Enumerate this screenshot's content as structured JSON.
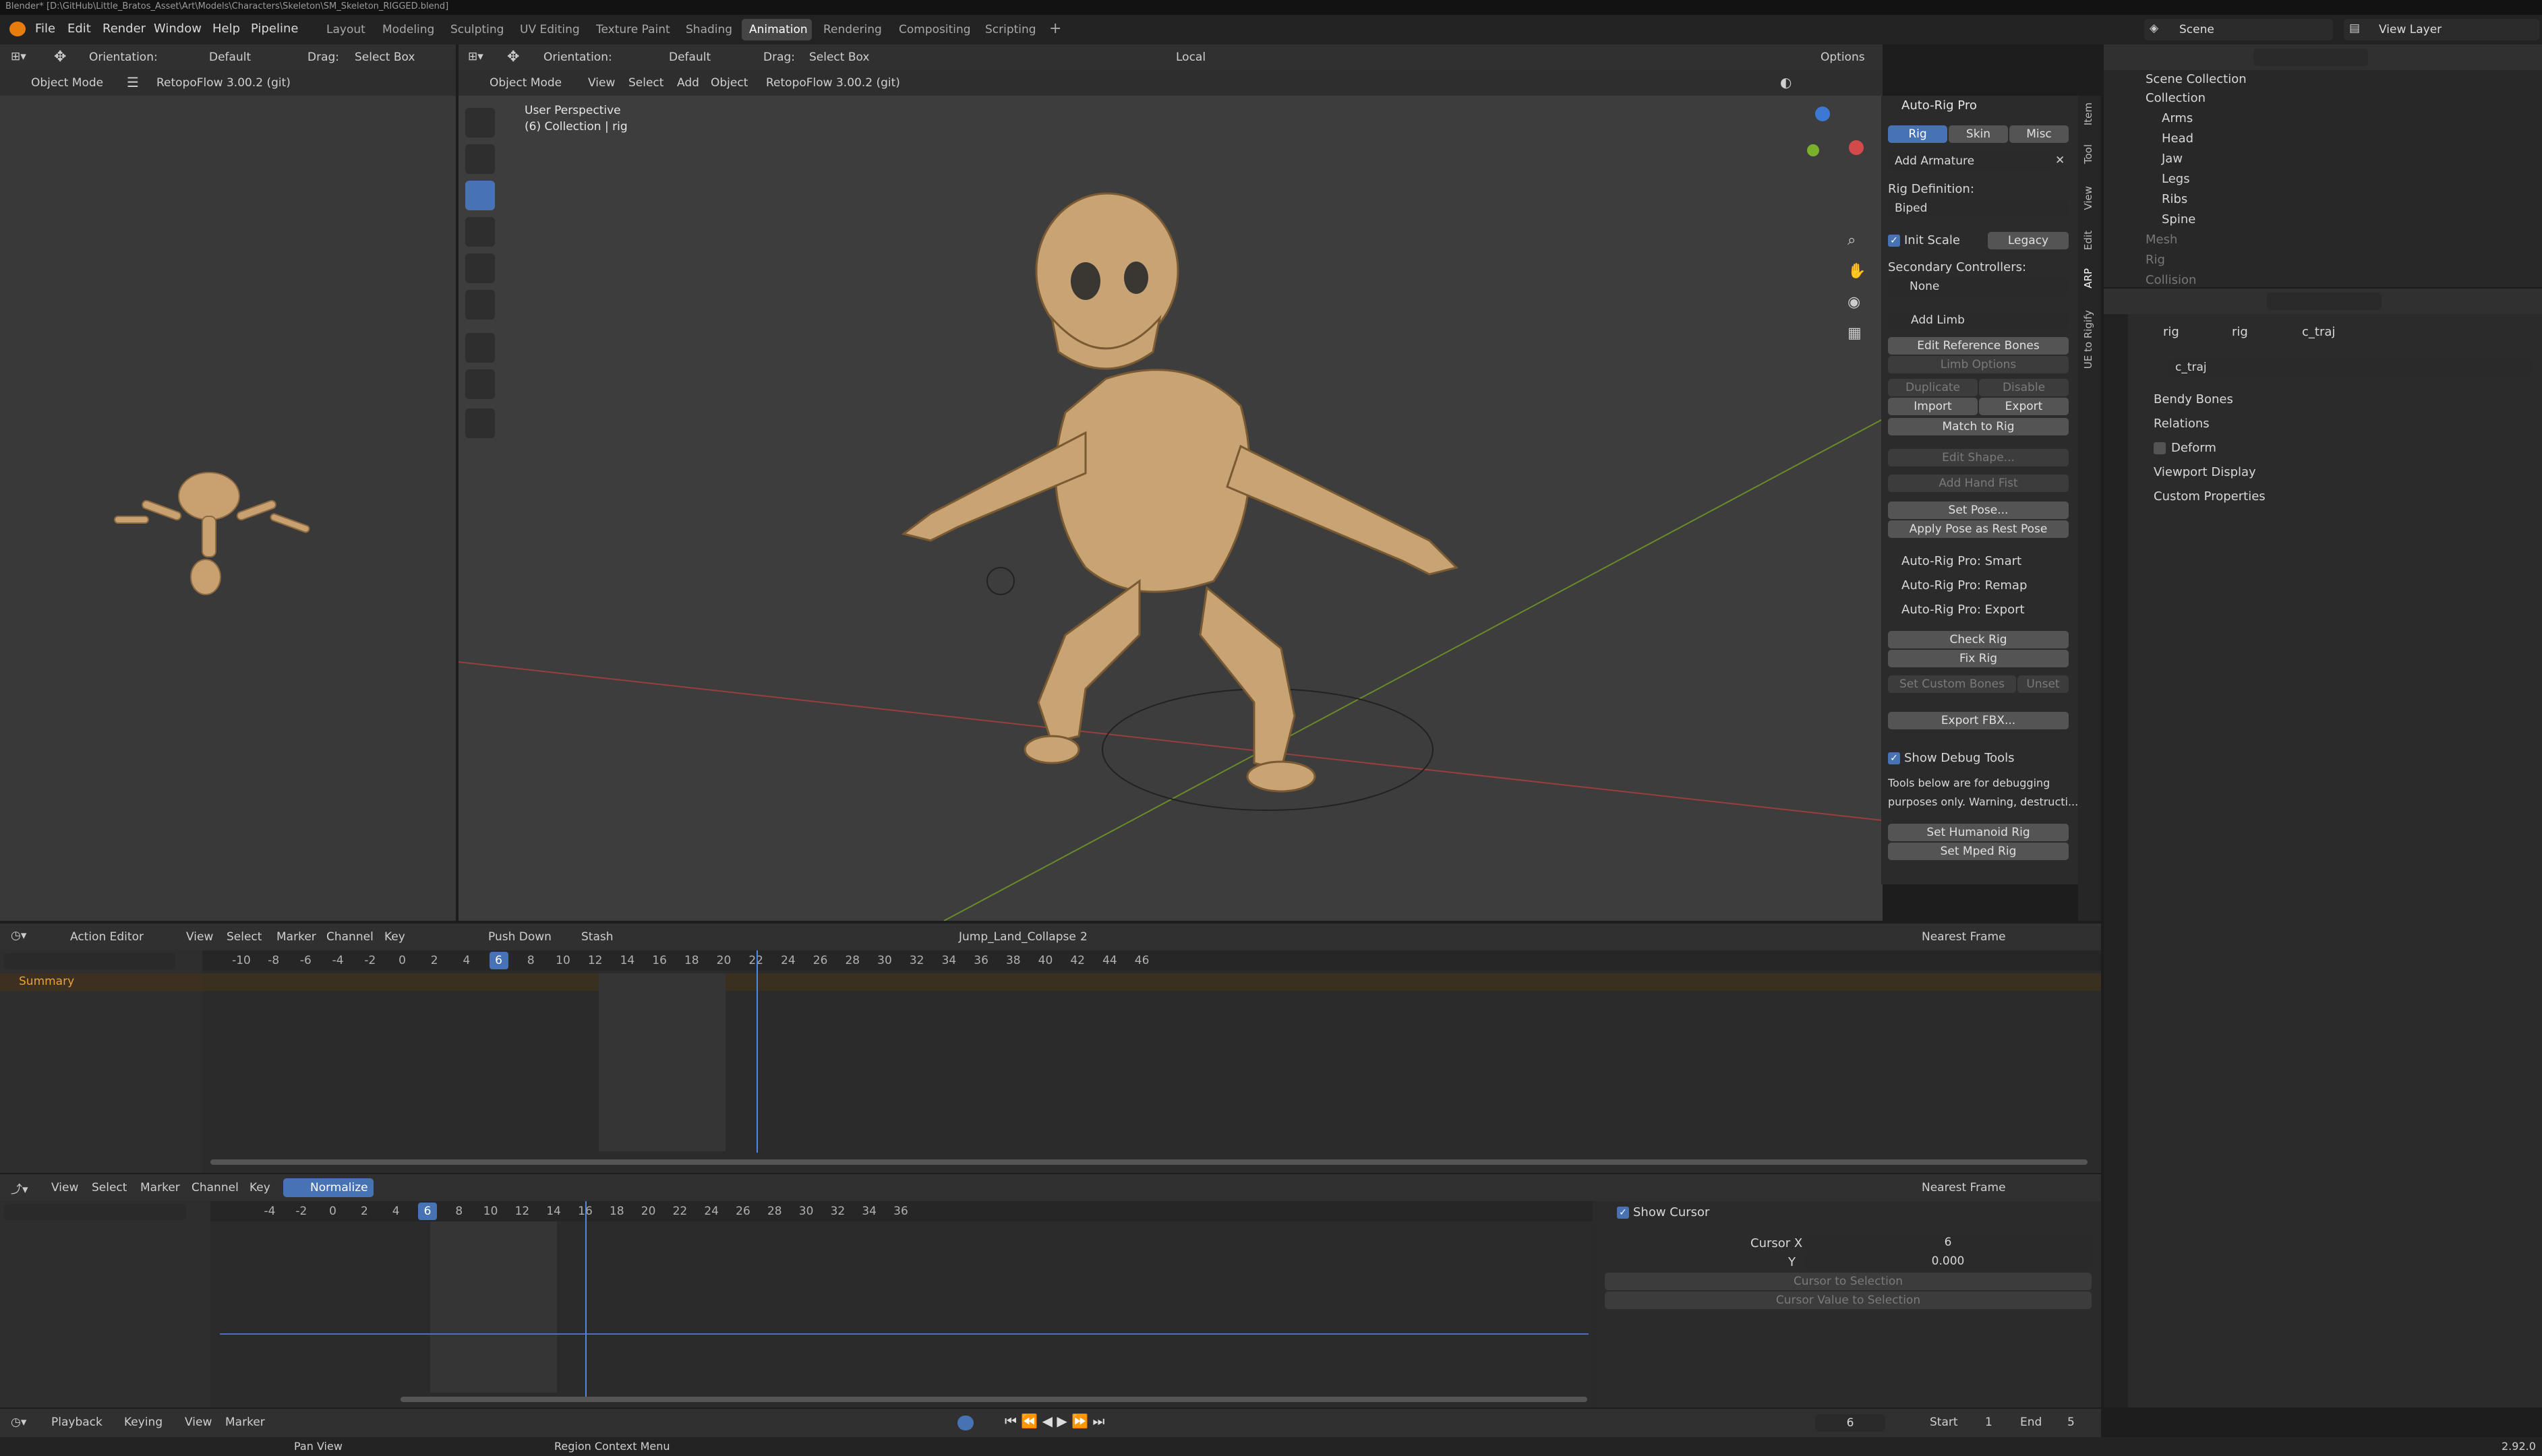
{
  "window_title": "Blender* [D:\\GitHub\\Little_Bratos_Asset\\Art\\Models\\Characters\\Skeleton\\SM_Skeleton_RIGGED.blend]",
  "menu": [
    "File",
    "Edit",
    "Render",
    "Window",
    "Help",
    "Pipeline"
  ],
  "workspaces": [
    "Layout",
    "Modeling",
    "Sculpting",
    "UV Editing",
    "Texture Paint",
    "Shading",
    "Animation",
    "Rendering",
    "Compositing",
    "Scripting"
  ],
  "active_workspace": "Animation",
  "scene": "Scene",
  "view_layer": "View Layer",
  "left_header": {
    "orientation_label": "Orientation:",
    "orientation": "Default",
    "drag_label": "Drag:",
    "drag": "Select Box",
    "mode": "Object Mode",
    "addon": "RetopoFlow 3.00.2 (git)"
  },
  "viewport_header": {
    "orientation_label": "Orientation:",
    "orientation": "Default",
    "drag_label": "Drag:",
    "drag": "Select Box",
    "transform": "Local",
    "mode": "Object Mode",
    "view": "View",
    "select": "Select",
    "add": "Add",
    "object": "Object",
    "addon": "RetopoFlow 3.00.2 (git)",
    "options": "Options"
  },
  "viewport_info": {
    "line1": "User Perspective",
    "line2": "(6) Collection | rig"
  },
  "side_tabs": [
    "Item",
    "Tool",
    "View",
    "Edit",
    "ARP",
    "UE to Rigify"
  ],
  "arp": {
    "title": "Auto-Rig Pro",
    "tabs": [
      "Rig",
      "Skin",
      "Misc"
    ],
    "add_armature": "Add Armature",
    "rig_definition_label": "Rig Definition:",
    "rig_definition": "Biped",
    "init_scale": "Init Scale",
    "legacy": "Legacy",
    "secondary_label": "Secondary Controllers:",
    "secondary": "None",
    "add_limb": "Add Limb",
    "edit_reference_bones": "Edit Reference Bones",
    "limb_options": "Limb Options",
    "duplicate": "Duplicate",
    "disable": "Disable",
    "import": "Import",
    "export": "Export",
    "match_to_rig": "Match to Rig",
    "edit_shape": "Edit Shape...",
    "add_hand_fist": "Add Hand Fist",
    "set_pose": "Set Pose...",
    "apply_pose": "Apply Pose as Rest Pose",
    "smart": "Auto-Rig Pro: Smart",
    "remap": "Auto-Rig Pro: Remap",
    "export_panel": "Auto-Rig Pro: Export",
    "check_rig": "Check Rig",
    "fix_rig": "Fix Rig",
    "set_custom_bones": "Set Custom Bones",
    "unset": "Unset",
    "export_fbx": "Export FBX...",
    "show_debug": "Show Debug Tools",
    "debug_line1": "Tools below are for debugging",
    "debug_line2": "purposes only. Warning, destructi...",
    "set_humanoid": "Set Humanoid Rig",
    "set_mped": "Set Mped Rig"
  },
  "outliner": {
    "scene_collection": "Scene Collection",
    "collection": "Collection",
    "items": [
      "Arms",
      "Head",
      "Jaw",
      "Legs",
      "Ribs",
      "Spine"
    ],
    "hidden_items": [
      "Mesh",
      "Rig",
      "Collision"
    ]
  },
  "properties": {
    "breadcrumb": [
      "rig",
      "rig",
      "c_traj"
    ],
    "bone_name": "c_traj",
    "sections": [
      "Bendy Bones",
      "Relations",
      "Deform",
      "Viewport Display",
      "Custom Properties"
    ]
  },
  "action_editor": {
    "mode": "Action Editor",
    "menus": [
      "View",
      "Select",
      "Marker",
      "Channel",
      "Key"
    ],
    "push_down": "Push Down",
    "stash": "Stash",
    "action": "Jump_Land_Collapse",
    "users": "2",
    "snap": "Nearest Frame",
    "summary": "Summary",
    "ticks": [
      "-10",
      "-8",
      "-6",
      "-4",
      "-2",
      "0",
      "2",
      "4",
      "6",
      "8",
      "10",
      "12",
      "14",
      "16",
      "18",
      "20",
      "22",
      "24",
      "26",
      "28",
      "30",
      "32",
      "34",
      "36",
      "38",
      "40",
      "42",
      "44",
      "46"
    ],
    "current_frame": "6"
  },
  "graph_editor": {
    "menus": [
      "View",
      "Select",
      "Marker",
      "Channel",
      "Key"
    ],
    "normalize": "Normalize",
    "snap": "Nearest Frame",
    "ticks": [
      "-4",
      "-2",
      "0",
      "2",
      "4",
      "6",
      "8",
      "10",
      "12",
      "14",
      "16",
      "18",
      "20",
      "22",
      "24",
      "26",
      "28",
      "30",
      "32",
      "34",
      "36"
    ],
    "current_frame": "6",
    "show_cursor": "Show Cursor",
    "cursor_x_label": "Cursor X",
    "cursor_x": "6",
    "cursor_y_label": "Y",
    "cursor_y": "0.000",
    "cursor_to_selection": "Cursor to Selection",
    "cursor_value_to_selection": "Cursor Value to Selection"
  },
  "timeline": {
    "menus": [
      "Playback",
      "Keying",
      "View",
      "Marker"
    ],
    "frame": "6",
    "start_label": "Start",
    "start": "1",
    "end_label": "End",
    "end": "5"
  },
  "status": {
    "pan": "Pan View",
    "context": "Region Context Menu",
    "version": "2.92.0"
  }
}
